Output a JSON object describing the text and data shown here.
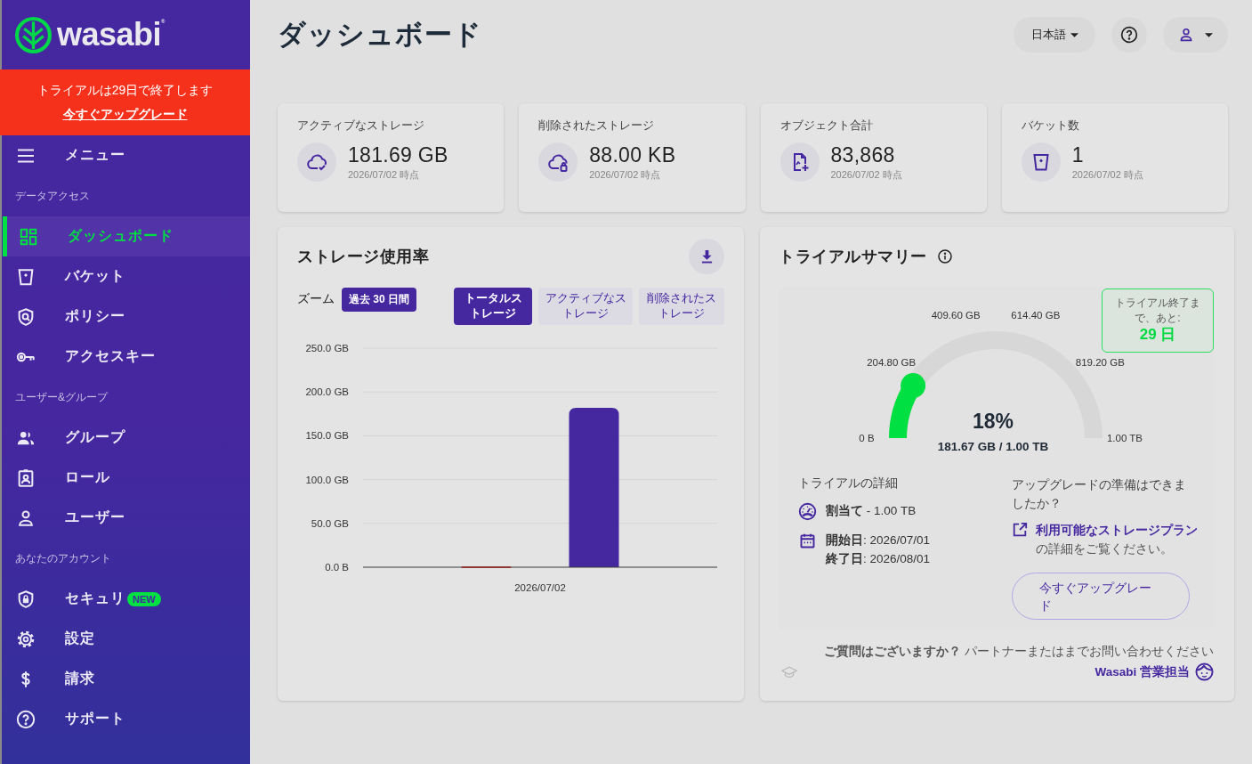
{
  "sidebar": {
    "logo": "wasabi$^{®}$",
    "trial_banner": {
      "text": "トライアルは29日で終了します",
      "link": "今すぐアップグレード"
    },
    "menu_toggle": "メニュー",
    "sections": [
      {
        "heading": "データアクセス",
        "items": [
          {
            "label": "ダッシュボード",
            "selected": true
          },
          {
            "label": "バケット",
            "selected": false
          },
          {
            "label": "ポリシー",
            "selected": false
          },
          {
            "label": "アクセスキー",
            "selected": false
          }
        ]
      },
      {
        "heading": "ユーザー&グループ",
        "items": [
          {
            "label": "グループ",
            "selected": false
          },
          {
            "label": "ロール",
            "selected": false
          },
          {
            "label": "ユーザー",
            "selected": false
          }
        ]
      },
      {
        "heading": "あなたのアカウント",
        "items": [
          {
            "label": "セキュリ",
            "badge": "NEW",
            "selected": false
          },
          {
            "label": "設定",
            "selected": false
          },
          {
            "label": "請求",
            "selected": false
          },
          {
            "label": "サポート",
            "selected": false
          }
        ]
      }
    ]
  },
  "header": {
    "title": "ダッシュボード",
    "language": "日本語"
  },
  "stats": [
    {
      "label": "アクティブなストレージ",
      "value": "181.69 GB",
      "as_of": "2026/07/02 時点"
    },
    {
      "label": "削除されたストレージ",
      "value": "88.00 KB",
      "as_of": "2026/07/02 時点"
    },
    {
      "label": "オブジェクト合計",
      "value": "83,868",
      "as_of": "2026/07/02 時点"
    },
    {
      "label": "バケット数",
      "value": "1",
      "as_of": "2026/07/02 時点"
    }
  ],
  "storage_usage": {
    "title": "ストレージ使用率",
    "zoom_label": "ズーム",
    "zoom_range": "過去 30 日間",
    "toggles": [
      {
        "label": "トータルストレージ",
        "selected": true
      },
      {
        "label": "アクティブなストレージ",
        "selected": false
      },
      {
        "label": "削除されたストレージ",
        "selected": false
      }
    ],
    "chart_data": {
      "type": "bar",
      "grid": true,
      "categories": [
        "2026/07/02"
      ],
      "series": [
        {
          "color": "#e53935",
          "values": [
            0
          ]
        },
        {
          "color": "#4527a0",
          "values": [
            182
          ]
        }
      ],
      "ylim": [
        0,
        250
      ],
      "yticks": [
        {
          "value": 0,
          "label": "0.0 B"
        },
        {
          "value": 50,
          "label": "50.0 GB"
        },
        {
          "value": 100,
          "label": "100.0 GB"
        },
        {
          "value": 150,
          "label": "150.0 GB"
        },
        {
          "value": 200,
          "label": "200.0 GB"
        },
        {
          "value": 250,
          "label": "250.0 GB"
        }
      ]
    }
  },
  "trial_summary": {
    "title": "トライアルサマリー",
    "gauge": {
      "level": 0.18,
      "percent": "18%",
      "usage": "181.67 GB / 1.00 TB",
      "scale": [
        "0 B",
        "204.80 GB",
        "409.60 GB",
        "614.40 GB",
        "819.20 GB",
        "1.00 TB"
      ]
    },
    "remaining": {
      "caption": "トライアル終了まで、あと:",
      "days": "29 日"
    },
    "details": {
      "heading": "トライアルの詳細",
      "quota": "**割当て** - 1.00 TB",
      "dates": [
        "**開始日**: 2026/07/01",
        "**終了日**: 2026/08/01"
      ]
    },
    "upgrade": {
      "question": "アップグレードの準備はできましたか？",
      "link": "利用可能なストレージプラン",
      "link_suffix": "の詳細をご覧ください。",
      "button": "今すぐアップグレード"
    },
    "contact": {
      "text": "**ご質問はございますか？** パートナーまたはまでお問い合わせください",
      "link": "Wasabi 営業担当"
    }
  }
}
